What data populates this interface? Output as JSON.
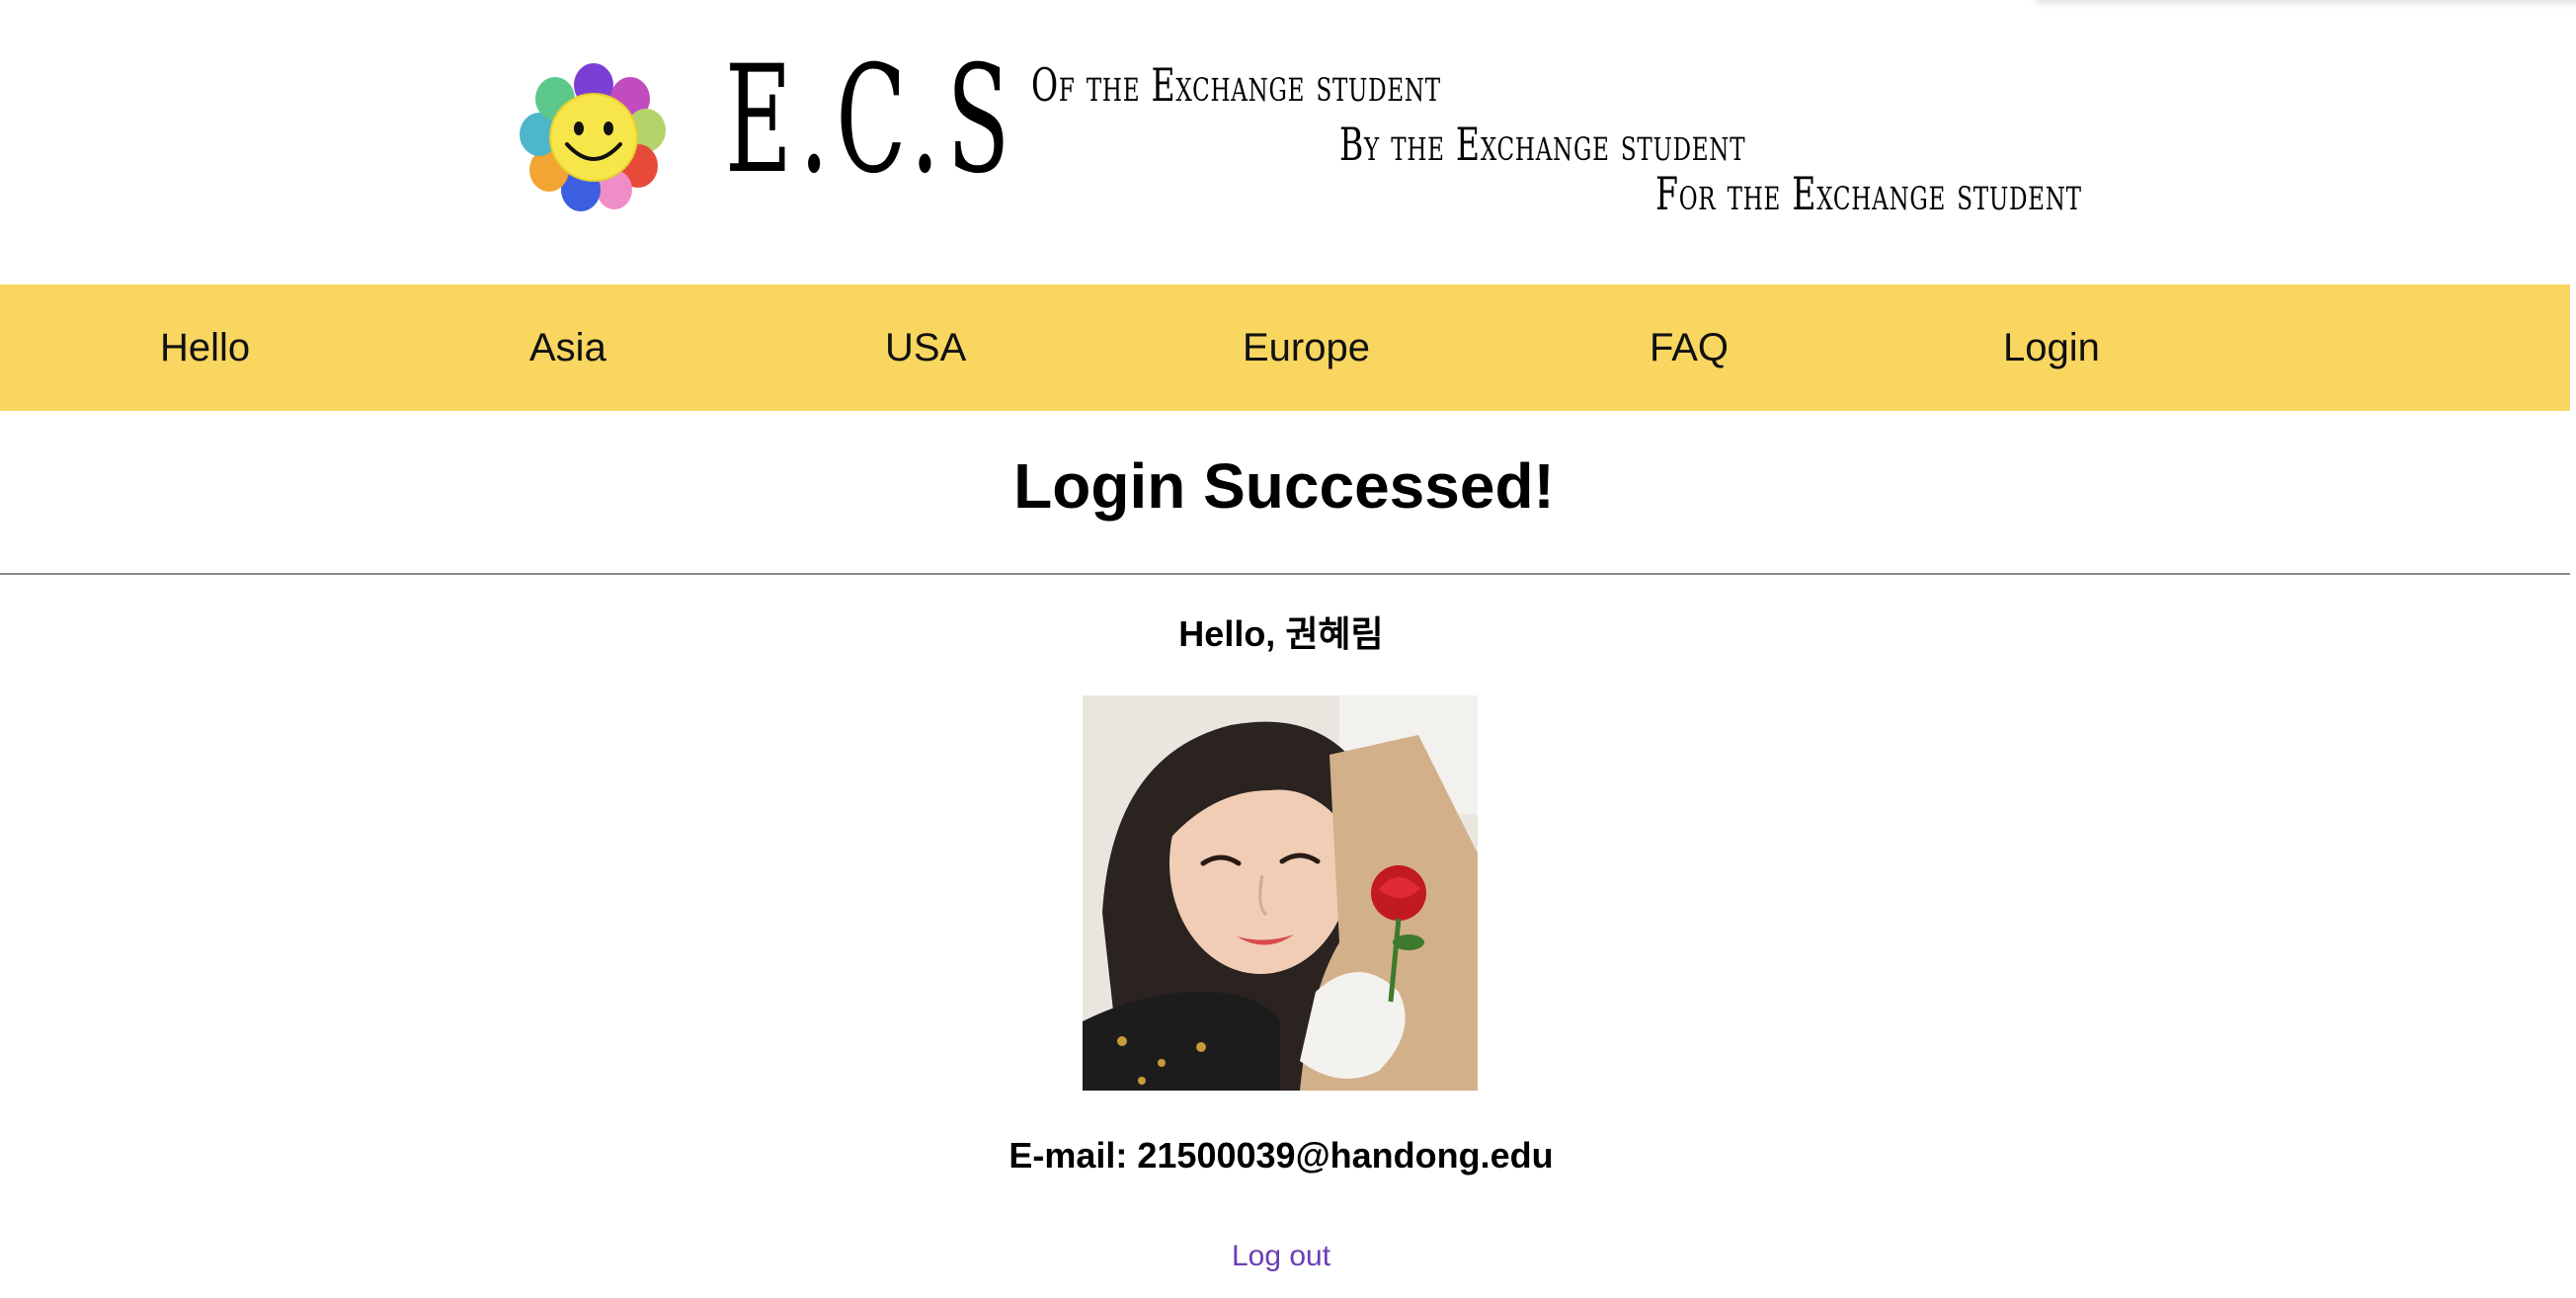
{
  "header": {
    "logo_text": "E.C.S",
    "taglines": [
      "Of the Exchange student",
      "By the Exchange student",
      "For the Exchange student"
    ]
  },
  "nav": {
    "items": [
      "Hello",
      "Asia",
      "USA",
      "Europe",
      "FAQ",
      "Login"
    ],
    "background": "#f8d660"
  },
  "main": {
    "title": "Login Successed!",
    "greeting": "Hello, 권혜림",
    "email_label": "E-mail:",
    "email_value": "21500039@handong.edu",
    "logout_label": "Log out",
    "logout_color": "#6a3fb5"
  },
  "icons": {
    "logo": "smiley-flower-icon",
    "photo": "profile-photo"
  }
}
